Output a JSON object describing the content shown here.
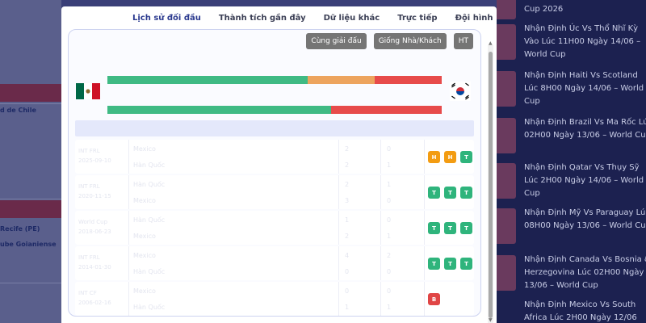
{
  "background_left": {
    "items": [
      {
        "text": "d de Chile"
      },
      {
        "text": "Recife (PE)"
      },
      {
        "text": "ube Goianiense"
      }
    ]
  },
  "background_right": {
    "news": [
      "Cup 2026",
      "Nhận Định Úc Vs Thổ Nhĩ Kỳ Vào Lúc 11H00 Ngày 14/06 – World Cup",
      "Nhận Định Haiti Vs Scotland Lúc 8H00 Ngày 14/06 – World Cup",
      "Nhận Định Brazil Vs Ma Rốc Lúc 02H00 Ngày 13/06 – World Cup",
      "Nhận Định Qatar Vs Thụy Sỹ Lúc 2H00 Ngày 14/06 – World Cup",
      "Nhận Định Mỹ Vs Paraguay Lúc 08H00 Ngày 13/06 – World Cup",
      "Nhận Định Canada Vs Bosnia & Herzegovina Lúc 02H00 Ngày 13/06 – World Cup",
      "Nhận Định Mexico Vs South Africa Lúc 2H00 Ngày 12/06"
    ]
  },
  "tabs": [
    {
      "label": "Lịch sử đối đầu",
      "active": true
    },
    {
      "label": "Thành tích gần đây",
      "active": false
    },
    {
      "label": "Dữ liệu khác",
      "active": false
    },
    {
      "label": "Trực tiếp",
      "active": false
    },
    {
      "label": "Đội hình",
      "active": false
    }
  ],
  "filters": {
    "same_league": "Cùng giải đấu",
    "same_home_away": "Giống Nhà/Khách",
    "ht": "HT"
  },
  "summary": {
    "bar1": {
      "win": 60,
      "draw": 20,
      "loss": 20
    },
    "bar2": {
      "win": 67,
      "draw": 0,
      "loss": 33
    },
    "colors": {
      "win": "#3fba84",
      "draw": "#eda45e",
      "loss": "#e74b4b"
    }
  },
  "teams": {
    "home": "Mexico",
    "away": "Hàn Quốc"
  },
  "matches": [
    {
      "league": "INT FRL",
      "date": "2025-09-10",
      "team1": "Mexico",
      "team2": "Hàn Quốc",
      "s1": "2",
      "s2": "2",
      "h1": "0",
      "h2": "1",
      "badges": [
        "H",
        "H",
        "T"
      ]
    },
    {
      "league": "INT FRL",
      "date": "2020-11-15",
      "team1": "Hàn Quốc",
      "team2": "Mexico",
      "s1": "2",
      "s2": "3",
      "h1": "1",
      "h2": "0",
      "badges": [
        "T",
        "T",
        "T"
      ]
    },
    {
      "league": "World Cup",
      "date": "2018-06-23",
      "team1": "Hàn Quốc",
      "team2": "Mexico",
      "s1": "1",
      "s2": "2",
      "h1": "0",
      "h2": "1",
      "badges": [
        "T",
        "T",
        "T"
      ]
    },
    {
      "league": "INT FRL",
      "date": "2014-01-30",
      "team1": "Mexico",
      "team2": "Hàn Quốc",
      "s1": "4",
      "s2": "0",
      "h1": "2",
      "h2": "0",
      "badges": [
        "T",
        "T",
        "T"
      ]
    },
    {
      "league": "INT CF",
      "date": "2006-02-16",
      "team1": "Mexico",
      "team2": "Hàn Quốc",
      "s1": "0",
      "s2": "1",
      "h1": "0",
      "h2": "1",
      "badges": [
        "B"
      ]
    }
  ]
}
